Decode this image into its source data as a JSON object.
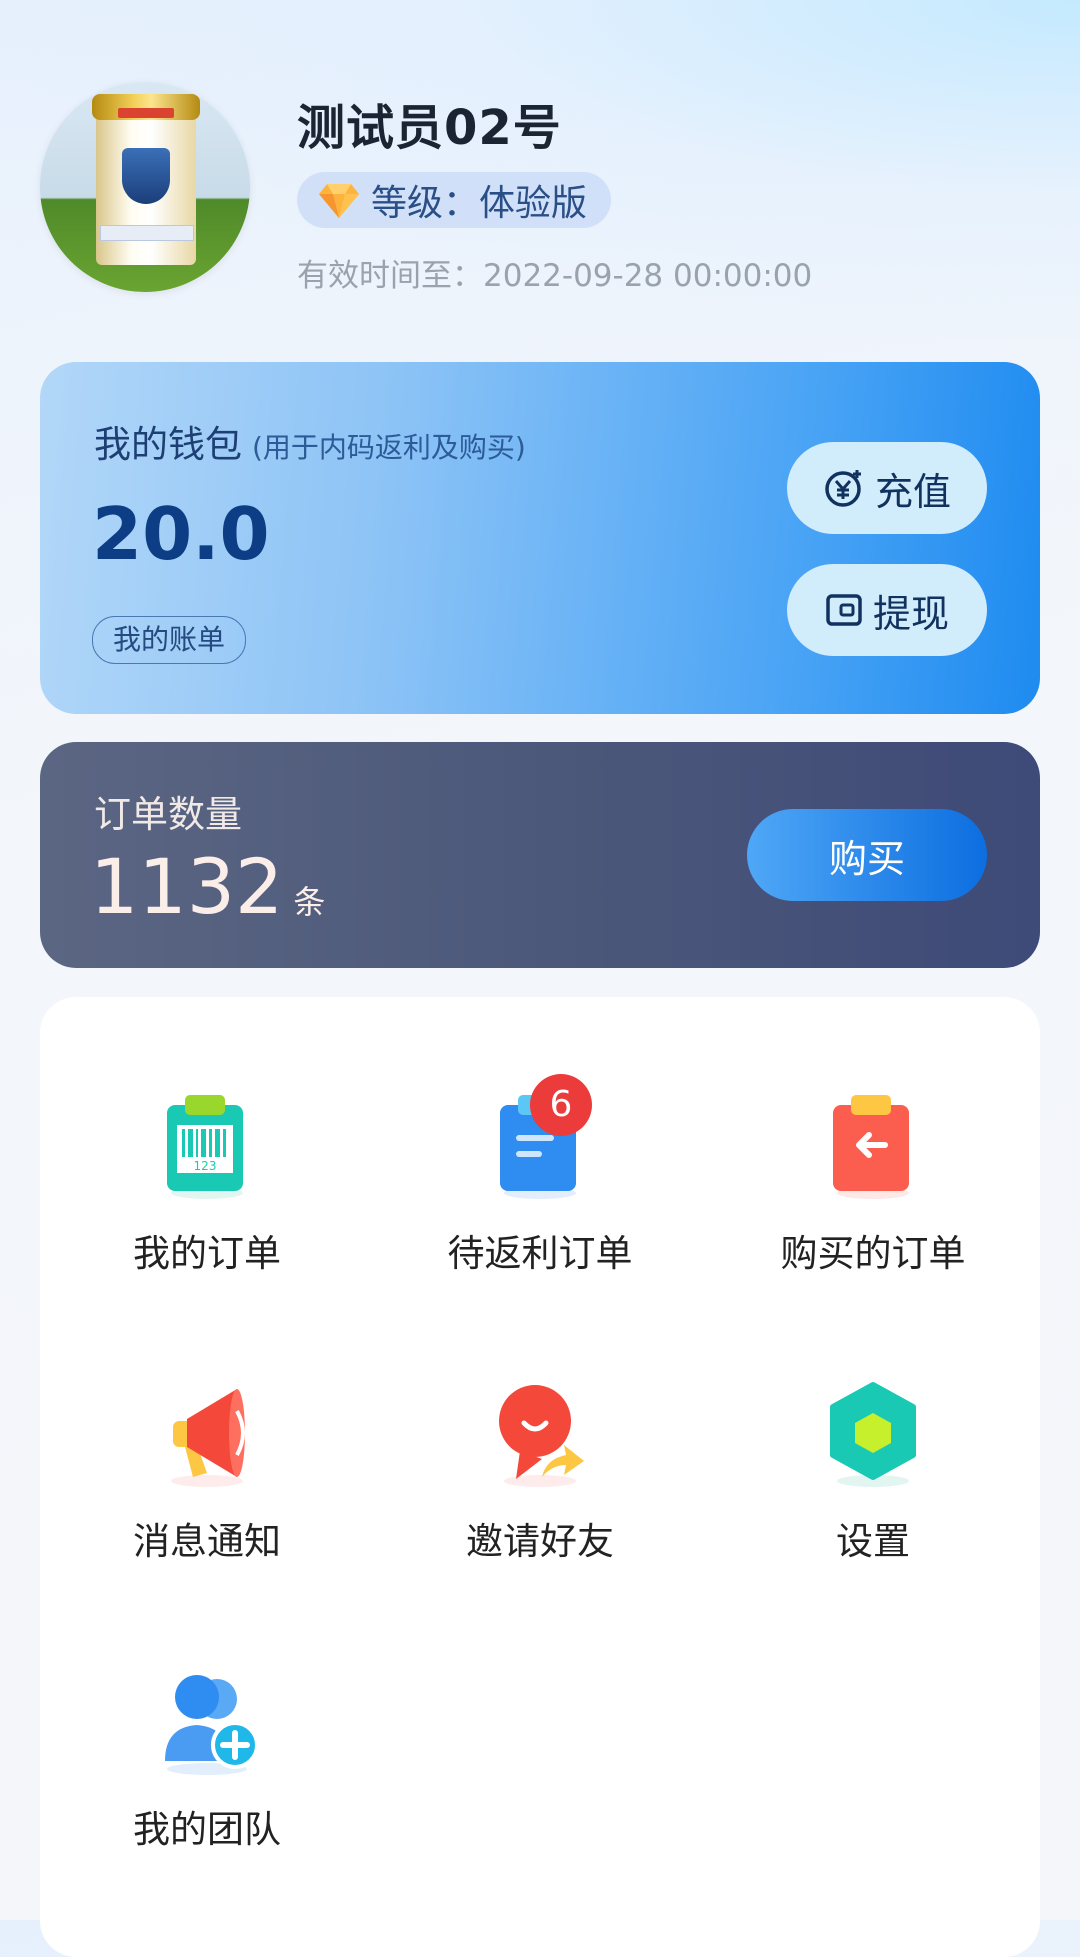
{
  "profile": {
    "name": "测试员02号",
    "level": "等级：体验版",
    "expiry": "有效时间至：2022-09-28 00:00:00"
  },
  "wallet": {
    "title": "我的钱包",
    "subtitle": "(用于内码返利及购买)",
    "amount": "20.0",
    "bill_label": "我的账单",
    "recharge_label": "充值",
    "withdraw_label": "提现"
  },
  "orders": {
    "title": "订单数量",
    "count": "1132",
    "unit": "条",
    "buy_label": "购买"
  },
  "menu": {
    "items": [
      {
        "label": "我的订单",
        "icon": "barcode-clipboard-icon"
      },
      {
        "label": "待返利订单",
        "icon": "document-clipboard-icon",
        "badge": "6"
      },
      {
        "label": "购买的订单",
        "icon": "return-clipboard-icon"
      },
      {
        "label": "消息通知",
        "icon": "megaphone-icon"
      },
      {
        "label": "邀请好友",
        "icon": "invite-share-icon"
      },
      {
        "label": "设置",
        "icon": "hexagon-settings-icon"
      },
      {
        "label": "我的团队",
        "icon": "team-add-icon"
      }
    ]
  },
  "colors": {
    "accent_blue": "#1e8bf0",
    "orders_bg": "#4b5779",
    "badge_red": "#ec3b3b"
  }
}
